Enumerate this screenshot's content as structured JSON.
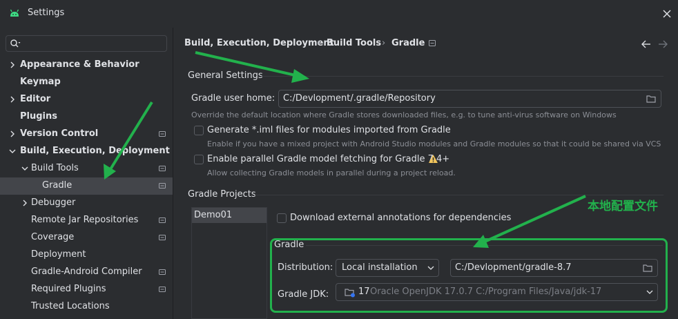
{
  "window": {
    "title": "Settings",
    "app_icon": "android-icon",
    "close_icon": "close-icon"
  },
  "sidebar": {
    "search": {
      "placeholder": "",
      "icon": "search-icon"
    },
    "items": [
      {
        "label": "Appearance & Behavior",
        "bold": true,
        "expandable": true,
        "expanded": false,
        "pin": false
      },
      {
        "label": "Keymap",
        "bold": true,
        "expandable": false,
        "pin": false
      },
      {
        "label": "Editor",
        "bold": true,
        "expandable": true,
        "expanded": false,
        "pin": false
      },
      {
        "label": "Plugins",
        "bold": true,
        "expandable": false,
        "pin": false
      },
      {
        "label": "Version Control",
        "bold": true,
        "expandable": true,
        "expanded": false,
        "pin": true
      },
      {
        "label": "Build, Execution, Deployment",
        "bold": true,
        "expandable": true,
        "expanded": true,
        "pin": false
      },
      {
        "label": "Build Tools",
        "bold": false,
        "expandable": true,
        "expanded": true,
        "pin": true
      },
      {
        "label": "Gradle",
        "bold": false,
        "expandable": false,
        "pin": true,
        "selected": true
      },
      {
        "label": "Debugger",
        "bold": false,
        "expandable": true,
        "expanded": false,
        "pin": false
      },
      {
        "label": "Remote Jar Repositories",
        "bold": false,
        "expandable": false,
        "pin": true
      },
      {
        "label": "Coverage",
        "bold": false,
        "expandable": false,
        "pin": true
      },
      {
        "label": "Deployment",
        "bold": false,
        "expandable": false,
        "pin": false
      },
      {
        "label": "Gradle-Android Compiler",
        "bold": false,
        "expandable": false,
        "pin": true
      },
      {
        "label": "Required Plugins",
        "bold": false,
        "expandable": false,
        "pin": true
      },
      {
        "label": "Trusted Locations",
        "bold": false,
        "expandable": false,
        "pin": false
      }
    ]
  },
  "breadcrumb": {
    "parts": [
      "Build, Execution, Deployment",
      "Build Tools",
      "Gradle"
    ],
    "separator": "›"
  },
  "nav": {
    "back_icon": "arrow-left-icon",
    "forward_icon": "arrow-right-icon"
  },
  "general": {
    "title": "General Settings",
    "gradle_home_label": "Gradle user home:",
    "gradle_home_value": "C:/Devlopment/.gradle/Repository",
    "gradle_home_hint": "Override the default location where Gradle stores downloaded files, e.g. to tune anti-virus software on Windows",
    "iml_label": "Generate *.iml files for modules imported from Gradle",
    "iml_hint": "Enable if you have a mixed project with Android Studio modules and Gradle modules so that it could be shared via VCS",
    "parallel_label": "Enable parallel Gradle model fetching for Gradle 7.4+",
    "parallel_hint": "Allow collecting Gradle models in parallel during a project reload."
  },
  "projects": {
    "title": "Gradle Projects",
    "items": [
      "Demo01"
    ],
    "annotations_label": "Download external annotations for dependencies",
    "gradle_group": "Gradle",
    "distribution_label": "Distribution:",
    "distribution_value": "Local installation",
    "distribution_path": "C:/Devlopment/gradle-8.7",
    "jdk_label": "Gradle JDK:",
    "jdk_version": "17",
    "jdk_value": "Oracle OpenJDK 17.0.7 C:/Program Files/Java/jdk-17"
  },
  "annotation": {
    "text": "本地配置文件",
    "color": "#22b14c"
  },
  "colors": {
    "accent_green": "#22b14c",
    "selection": "#43454a",
    "background": "#2b2d30",
    "warning": "#f2c55c"
  }
}
